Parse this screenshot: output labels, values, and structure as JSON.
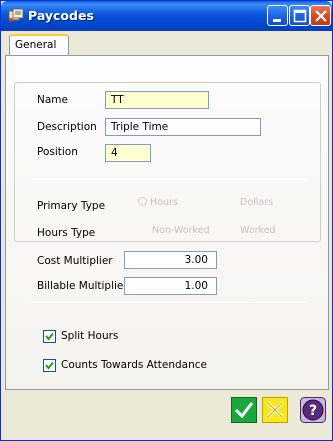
{
  "window": {
    "title": "Paycodes"
  },
  "tabs": [
    {
      "label": "General"
    }
  ],
  "form": {
    "name": {
      "label": "Name",
      "value": "TT"
    },
    "description": {
      "label": "Description",
      "value": "Triple Time"
    },
    "position": {
      "label": "Position",
      "value": "4"
    },
    "primary_type": {
      "label": "Primary Type",
      "options": [
        "Hours",
        "Dollars"
      ]
    },
    "hours_type": {
      "label": "Hours Type",
      "options": [
        "Non-Worked",
        "Worked"
      ]
    },
    "cost_multiplier": {
      "label": "Cost Multiplier",
      "value": "3.00"
    },
    "billable_multiplier": {
      "label": "Billable Multiplier",
      "value": "1.00"
    },
    "split_hours": {
      "label": "Split Hours",
      "checked": true
    },
    "counts_attendance": {
      "label": "Counts Towards Attendance",
      "checked": true
    }
  },
  "buttons": {
    "ok": "ok",
    "cancel": "cancel",
    "help": "help"
  },
  "colors": {
    "titlebar": "#0054e3",
    "ok_green": "#19a83c",
    "cancel_yellow": "#f5e000",
    "help_purple": "#5a2a78"
  }
}
